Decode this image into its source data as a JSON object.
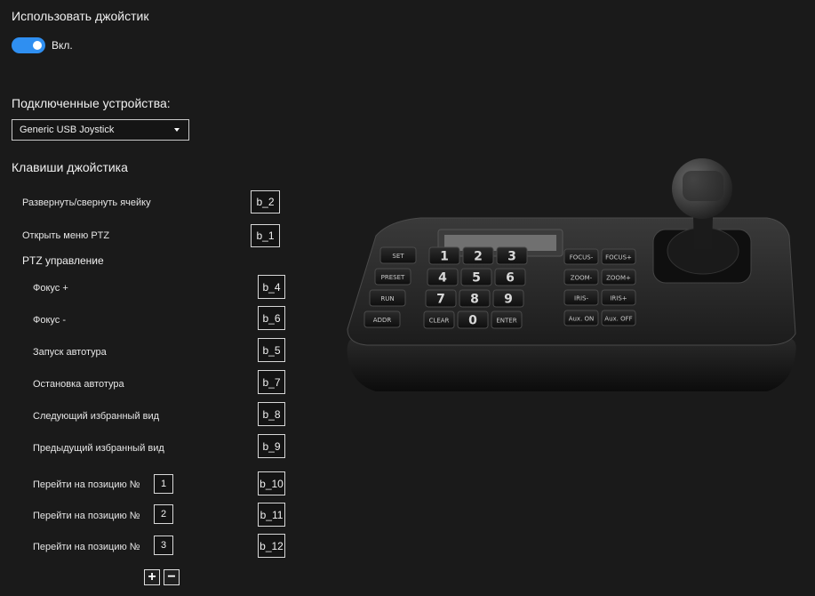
{
  "use_joystick": {
    "title": "Использовать джойстик",
    "toggle_label": "Вкл.",
    "enabled": true
  },
  "devices": {
    "title": "Подключенные устройства:",
    "selected": "Generic  USB  Joystick"
  },
  "keys": {
    "title": "Клавиши джойстика",
    "expand": {
      "label": "Развернуть/свернуть ячейку",
      "key": "b_2"
    },
    "ptz_menu": {
      "label": "Открыть меню PTZ",
      "key": "b_1"
    },
    "ptz_title": "PTZ управление",
    "ptz": [
      {
        "label": "Фокус +",
        "key": "b_4"
      },
      {
        "label": "Фокус -",
        "key": "b_6"
      },
      {
        "label": "Запуск автотура",
        "key": "b_5"
      },
      {
        "label": "Остановка автотура",
        "key": "b_7"
      },
      {
        "label": "Следующий избранный вид",
        "key": "b_8"
      },
      {
        "label": "Предыдущий избранный вид",
        "key": "b_9"
      }
    ],
    "positions": [
      {
        "label": "Перейти на позицию №",
        "position": "1",
        "key": "b_10"
      },
      {
        "label": "Перейти на позицию №",
        "position": "2",
        "key": "b_11"
      },
      {
        "label": "Перейти на позицию №",
        "position": "3",
        "key": "b_12"
      }
    ],
    "add_icon": "plus-icon",
    "remove_icon": "minus-icon"
  },
  "keyboard_image": {
    "left_keys": [
      "SET",
      "PRESET",
      "RUN",
      "ADDR"
    ],
    "num_keys": [
      "1",
      "2",
      "3",
      "4",
      "5",
      "6",
      "7",
      "8",
      "9",
      "CLEAR",
      "0",
      "ENTER"
    ],
    "right_keys": [
      "FOCUS-",
      "FOCUS+",
      "ZOOM-",
      "ZOOM+",
      "IRIS-",
      "IRIS+",
      "Aux. ON",
      "Aux. OFF"
    ]
  },
  "colors": {
    "accent": "#2f8ff1",
    "background": "#1a1a1a"
  }
}
